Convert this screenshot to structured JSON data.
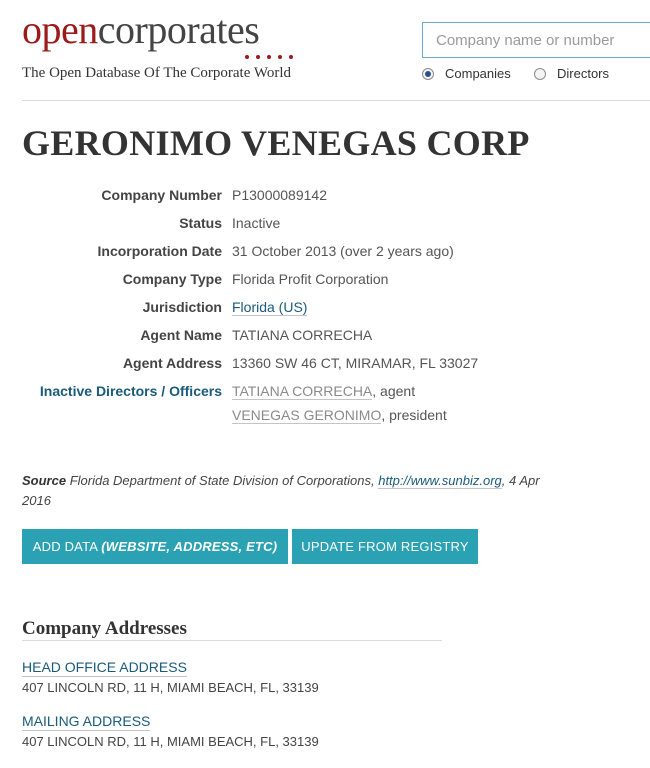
{
  "header": {
    "logo_open": "open",
    "logo_corp": "corporates",
    "tagline": "The Open Database Of The Corporate World",
    "search_placeholder": "Company name or number",
    "radio_companies": "Companies",
    "radio_directors": "Directors",
    "selected_radio": "Companies"
  },
  "company": {
    "name": "GERONIMO VENEGAS CORP",
    "attributes": [
      {
        "label": "Company Number",
        "value": "P13000089142"
      },
      {
        "label": "Status",
        "value": "Inactive"
      },
      {
        "label": "Incorporation Date",
        "value": "31 October 2013 (over 2 years ago)"
      },
      {
        "label": "Company Type",
        "value": "Florida Profit Corporation"
      },
      {
        "label": "Jurisdiction",
        "value": "Florida (US)"
      },
      {
        "label": "Agent Name",
        "value": "TATIANA CORRECHA"
      },
      {
        "label": "Agent Address",
        "value": "13360 SW 46 CT, MIRAMAR, FL 33027"
      }
    ],
    "officers_label": "Inactive Directors / Officers",
    "officers": [
      {
        "name": "TATIANA CORRECHA",
        "role": ", agent"
      },
      {
        "name": "VENEGAS GERONIMO",
        "role": ", president"
      }
    ]
  },
  "source": {
    "label": "Source",
    "text": " Florida Department of State Division of Corporations, ",
    "link": "http://www.sunbiz.org",
    "date": ", 4 Apr 2016"
  },
  "buttons": {
    "add_data_prefix": "ADD DATA ",
    "add_data_italic": "(WEBSITE, ADDRESS, ETC)",
    "update": "UPDATE FROM REGISTRY"
  },
  "addresses": {
    "title": "Company Addresses",
    "items": [
      {
        "label": "HEAD OFFICE ADDRESS",
        "address": "407 LINCOLN RD, 11 H, MIAMI BEACH, FL, 33139"
      },
      {
        "label": "MAILING ADDRESS",
        "address": "407 LINCOLN RD, 11 H, MIAMI BEACH, FL, 33139"
      }
    ]
  },
  "colors": {
    "brand_red": "#9b1b1b",
    "link_blue": "#1a5a7a",
    "button_teal": "#2aa2b3"
  }
}
